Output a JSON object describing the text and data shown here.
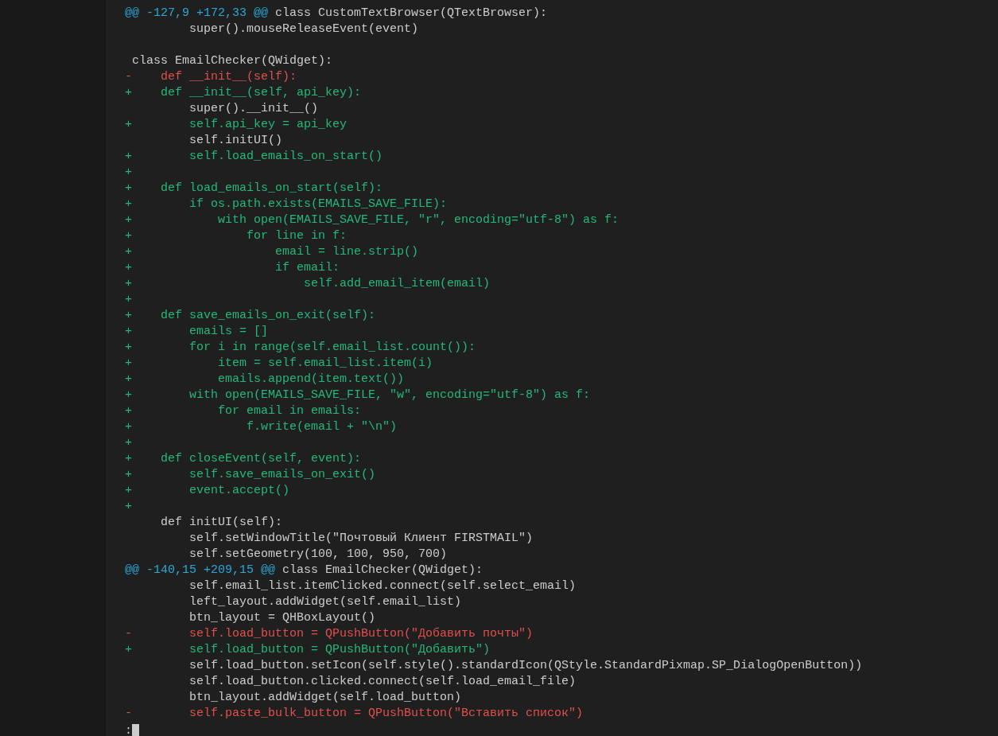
{
  "diff": {
    "lines": [
      {
        "kind": "hunk",
        "range": "@@ -127,9 +172,33 @@",
        "context": " class CustomTextBrowser(QTextBrowser):"
      },
      {
        "kind": "context",
        "text": "         super().mouseReleaseEvent(event)"
      },
      {
        "kind": "blank"
      },
      {
        "kind": "context",
        "text": " class EmailChecker(QWidget):"
      },
      {
        "kind": "remove",
        "text": "-    def __init__(self):"
      },
      {
        "kind": "add",
        "text": "+    def __init__(self, api_key):"
      },
      {
        "kind": "context",
        "text": "         super().__init__()"
      },
      {
        "kind": "add",
        "text": "+        self.api_key = api_key"
      },
      {
        "kind": "context",
        "text": "         self.initUI()"
      },
      {
        "kind": "add",
        "text": "+        self.load_emails_on_start()"
      },
      {
        "kind": "add",
        "text": "+"
      },
      {
        "kind": "add",
        "text": "+    def load_emails_on_start(self):"
      },
      {
        "kind": "add",
        "text": "+        if os.path.exists(EMAILS_SAVE_FILE):"
      },
      {
        "kind": "add",
        "text": "+            with open(EMAILS_SAVE_FILE, \"r\", encoding=\"utf-8\") as f:"
      },
      {
        "kind": "add",
        "text": "+                for line in f:"
      },
      {
        "kind": "add",
        "text": "+                    email = line.strip()"
      },
      {
        "kind": "add",
        "text": "+                    if email:"
      },
      {
        "kind": "add",
        "text": "+                        self.add_email_item(email)"
      },
      {
        "kind": "add",
        "text": "+"
      },
      {
        "kind": "add",
        "text": "+    def save_emails_on_exit(self):"
      },
      {
        "kind": "add",
        "text": "+        emails = []"
      },
      {
        "kind": "add",
        "text": "+        for i in range(self.email_list.count()):"
      },
      {
        "kind": "add",
        "text": "+            item = self.email_list.item(i)"
      },
      {
        "kind": "add",
        "text": "+            emails.append(item.text())"
      },
      {
        "kind": "add",
        "text": "+        with open(EMAILS_SAVE_FILE, \"w\", encoding=\"utf-8\") as f:"
      },
      {
        "kind": "add",
        "text": "+            for email in emails:"
      },
      {
        "kind": "add",
        "text": "+                f.write(email + \"\\n\")"
      },
      {
        "kind": "add",
        "text": "+"
      },
      {
        "kind": "add",
        "text": "+    def closeEvent(self, event):"
      },
      {
        "kind": "add",
        "text": "+        self.save_emails_on_exit()"
      },
      {
        "kind": "add",
        "text": "+        event.accept()"
      },
      {
        "kind": "add",
        "text": "+"
      },
      {
        "kind": "context",
        "text": "     def initUI(self):"
      },
      {
        "kind": "context",
        "text": "         self.setWindowTitle(\"Почтовый Клиент FIRSTMAIL\")"
      },
      {
        "kind": "context",
        "text": "         self.setGeometry(100, 100, 950, 700)"
      },
      {
        "kind": "hunk",
        "range": "@@ -140,15 +209,15 @@",
        "context": " class EmailChecker(QWidget):"
      },
      {
        "kind": "context",
        "text": "         self.email_list.itemClicked.connect(self.select_email)"
      },
      {
        "kind": "context",
        "text": "         left_layout.addWidget(self.email_list)"
      },
      {
        "kind": "context",
        "text": "         btn_layout = QHBoxLayout()"
      },
      {
        "kind": "remove",
        "text": "-        self.load_button = QPushButton(\"Добавить почты\")"
      },
      {
        "kind": "add",
        "text": "+        self.load_button = QPushButton(\"Добавить\")"
      },
      {
        "kind": "context",
        "text": "         self.load_button.setIcon(self.style().standardIcon(QStyle.StandardPixmap.SP_DialogOpenButton))"
      },
      {
        "kind": "context",
        "text": "         self.load_button.clicked.connect(self.load_email_file)"
      },
      {
        "kind": "context",
        "text": "         btn_layout.addWidget(self.load_button)"
      },
      {
        "kind": "remove",
        "text": "-        self.paste_bulk_button = QPushButton(\"Вставить список\")"
      }
    ]
  },
  "prompt": ":"
}
